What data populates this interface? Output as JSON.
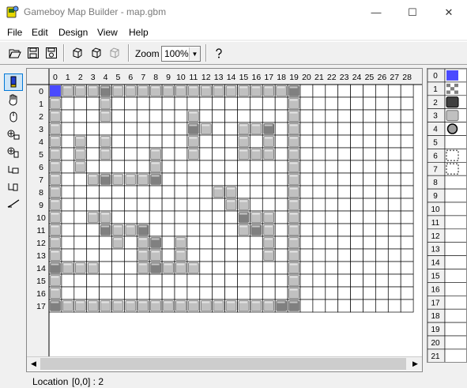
{
  "window": {
    "title": "Gameboy Map Builder - map.gbm",
    "minimize_glyph": "—",
    "maximize_glyph": "☐",
    "close_glyph": "✕"
  },
  "menu": [
    "File",
    "Edit",
    "Design",
    "View",
    "Help"
  ],
  "toolbar": {
    "icons": [
      "open-folder-icon",
      "save-icon",
      "save-as-icon",
      "copy-icon",
      "paste-icon",
      "paste-disabled-icon",
      "help-icon"
    ],
    "zoom_label": "Zoom",
    "zoom_value": "100%"
  },
  "tools": [
    "pencil-icon",
    "hand-icon",
    "mouse-icon",
    "insert-row-icon",
    "insert-column-icon",
    "delete-row-icon",
    "delete-column-icon",
    "check-icon"
  ],
  "map": {
    "columns": [
      "0",
      "1",
      "2",
      "3",
      "4",
      "5",
      "6",
      "7",
      "8",
      "9",
      "10",
      "11",
      "12",
      "13",
      "14",
      "15",
      "16",
      "17",
      "18",
      "19",
      "20",
      "21",
      "22",
      "23",
      "24",
      "25",
      "26",
      "27",
      "28"
    ],
    "rows": [
      "0",
      "1",
      "2",
      "3",
      "4",
      "5",
      "6",
      "7",
      "8",
      "9",
      "10",
      "11",
      "12",
      "13",
      "14",
      "15",
      "16",
      "17"
    ],
    "selected_cell": [
      0,
      0
    ],
    "tiles": [
      [
        1,
        2,
        2,
        2,
        3,
        2,
        2,
        2,
        2,
        2,
        2,
        2,
        2,
        2,
        2,
        2,
        2,
        2,
        2,
        3
      ],
      [
        2,
        0,
        0,
        0,
        2,
        0,
        0,
        0,
        0,
        0,
        0,
        0,
        0,
        0,
        0,
        0,
        0,
        0,
        0,
        2
      ],
      [
        2,
        0,
        0,
        0,
        2,
        0,
        0,
        0,
        0,
        0,
        0,
        2,
        0,
        0,
        0,
        0,
        0,
        0,
        0,
        2
      ],
      [
        2,
        0,
        0,
        0,
        0,
        0,
        0,
        0,
        0,
        0,
        0,
        3,
        2,
        0,
        0,
        2,
        2,
        3,
        0,
        2
      ],
      [
        2,
        0,
        2,
        0,
        2,
        0,
        0,
        0,
        0,
        0,
        0,
        2,
        0,
        0,
        0,
        2,
        0,
        2,
        0,
        2
      ],
      [
        2,
        0,
        2,
        0,
        2,
        0,
        0,
        0,
        2,
        0,
        0,
        2,
        0,
        0,
        0,
        2,
        2,
        2,
        0,
        2
      ],
      [
        2,
        0,
        2,
        0,
        0,
        0,
        0,
        0,
        2,
        0,
        0,
        0,
        0,
        0,
        0,
        0,
        0,
        0,
        0,
        2
      ],
      [
        2,
        0,
        0,
        2,
        3,
        2,
        2,
        2,
        3,
        0,
        0,
        0,
        0,
        0,
        0,
        0,
        0,
        0,
        0,
        2
      ],
      [
        2,
        0,
        0,
        0,
        0,
        0,
        0,
        0,
        0,
        0,
        0,
        0,
        0,
        2,
        2,
        0,
        0,
        0,
        0,
        2
      ],
      [
        2,
        0,
        0,
        0,
        0,
        0,
        0,
        0,
        0,
        0,
        0,
        0,
        0,
        0,
        2,
        2,
        0,
        0,
        0,
        2
      ],
      [
        2,
        0,
        0,
        2,
        2,
        0,
        0,
        0,
        0,
        0,
        0,
        0,
        0,
        0,
        0,
        3,
        2,
        2,
        0,
        2
      ],
      [
        2,
        0,
        0,
        0,
        3,
        2,
        2,
        3,
        0,
        0,
        0,
        0,
        0,
        0,
        0,
        2,
        3,
        2,
        0,
        2
      ],
      [
        2,
        0,
        0,
        0,
        0,
        2,
        0,
        2,
        3,
        0,
        2,
        0,
        0,
        0,
        0,
        0,
        0,
        2,
        0,
        2
      ],
      [
        2,
        0,
        0,
        0,
        0,
        0,
        0,
        2,
        2,
        0,
        2,
        0,
        0,
        0,
        0,
        0,
        0,
        2,
        0,
        2
      ],
      [
        3,
        2,
        2,
        2,
        0,
        0,
        0,
        2,
        3,
        2,
        2,
        2,
        0,
        0,
        0,
        0,
        0,
        0,
        0,
        2
      ],
      [
        2,
        0,
        0,
        0,
        0,
        0,
        0,
        0,
        0,
        0,
        0,
        0,
        0,
        0,
        0,
        0,
        0,
        0,
        0,
        2
      ],
      [
        2,
        0,
        0,
        0,
        0,
        0,
        0,
        0,
        0,
        0,
        0,
        0,
        0,
        0,
        0,
        0,
        0,
        0,
        0,
        2
      ],
      [
        3,
        2,
        2,
        2,
        2,
        2,
        2,
        2,
        2,
        2,
        2,
        2,
        2,
        2,
        2,
        2,
        2,
        2,
        3,
        3
      ]
    ]
  },
  "scrollbar": {
    "left_glyph": "◀",
    "right_glyph": "▶"
  },
  "palette": {
    "numbers": [
      "0",
      "1",
      "2",
      "3",
      "4",
      "5",
      "6",
      "7",
      "8",
      "9",
      "10",
      "11",
      "12",
      "13",
      "14",
      "15",
      "16",
      "17",
      "18",
      "19",
      "20",
      "21"
    ],
    "tile_kinds": [
      "blue",
      "checker",
      "dark",
      "plain",
      "ring",
      "blank",
      "dashed",
      "dashed",
      "blank",
      "blank",
      "blank",
      "blank",
      "blank",
      "blank",
      "blank",
      "blank",
      "blank",
      "blank",
      "blank",
      "blank",
      "blank",
      "blank"
    ]
  },
  "status": {
    "label": "Location",
    "value": "[0,0] : 2"
  },
  "colors": {
    "selected_tile": "#4a4aff",
    "grid_line": "#000000",
    "block_light": "#c0c0c0",
    "block_dark": "#808080",
    "header_bg": "#f0f0f0"
  }
}
